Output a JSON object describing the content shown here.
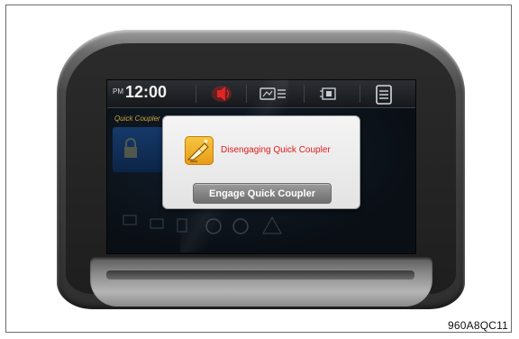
{
  "figure": {
    "caption": "960A8QC11"
  },
  "status_bar": {
    "ampm": "PM",
    "time": "12:00",
    "icons": [
      "warning-speaker-icon",
      "display-menu-icon",
      "camera-mode-icon",
      "menu-list-icon"
    ]
  },
  "background": {
    "subtitle": "Quick Coupler"
  },
  "dialog": {
    "icon": "quick-coupler-warning-icon",
    "message": "Disengaging Quick Coupler",
    "button_label": "Engage Quick Coupler"
  },
  "colors": {
    "alert_red": "#e11a1a",
    "icon_yellow": "#f2b630",
    "status_red": "#d21f1f",
    "bezel_grey": "#4a4a4a"
  }
}
